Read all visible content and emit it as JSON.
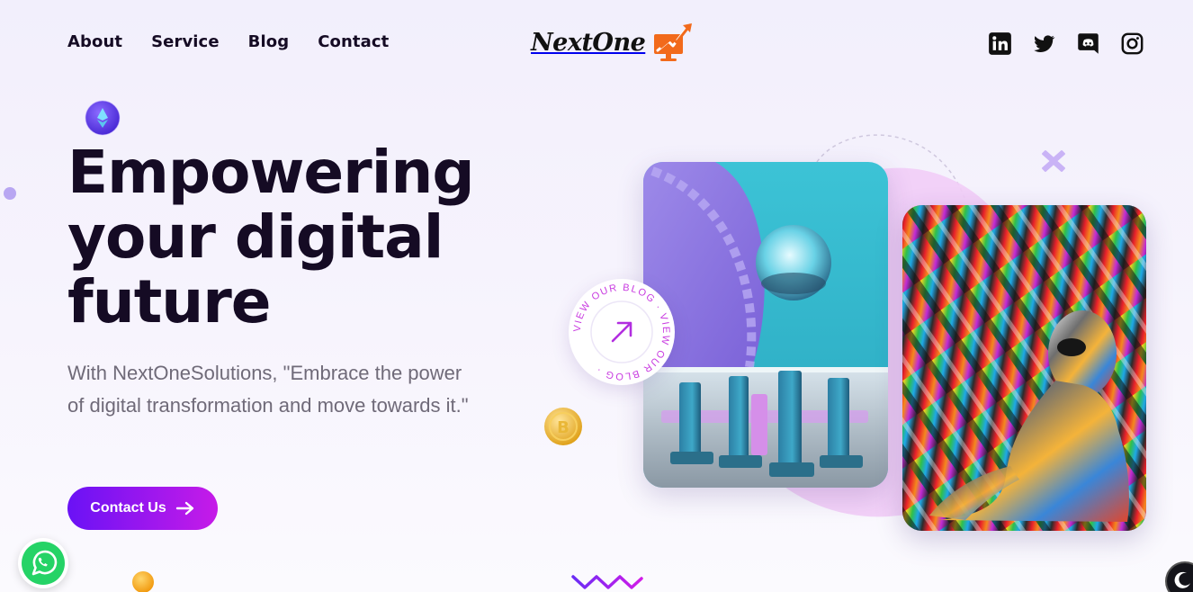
{
  "nav": {
    "links": [
      "About",
      "Service",
      "Blog",
      "Contact"
    ]
  },
  "logo": {
    "text": "NextOne"
  },
  "socials": [
    "linkedin-icon",
    "twitter-icon",
    "discord-icon",
    "instagram-icon"
  ],
  "hero": {
    "title_lines": [
      "Empowering",
      "your digital",
      "future"
    ],
    "subtitle": "With NextOneSolutions, \"Embrace the power of digital transformation and move towards it.\"",
    "cta_label": "Contact Us"
  },
  "badge": {
    "text": "VIEW OUR BLOG · VIEW OUR BLOG ·"
  },
  "colors": {
    "text_dark": "#150b24",
    "subtitle": "#6f6a78",
    "accent_purple": "#6a12f5",
    "accent_magenta": "#c61be8",
    "logo_orange": "#f26a1b",
    "blob_pink": "#f2cdf7",
    "whatsapp_green": "#25d366"
  }
}
